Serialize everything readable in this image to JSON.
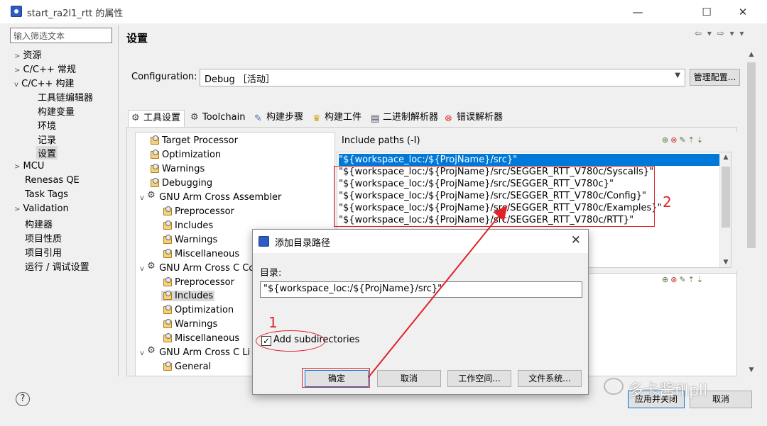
{
  "window": {
    "title": "start_ra2l1_rtt 的属性",
    "controls": [
      "—",
      "☐",
      "✕"
    ]
  },
  "left_panel": {
    "filter_placeholder": "输入筛选文本",
    "items": [
      {
        "label": "资源",
        "twisty": ">"
      },
      {
        "label": "C/C++ 常规",
        "twisty": ">"
      },
      {
        "label": "C/C++ 构建",
        "twisty": "v"
      },
      {
        "label": "工具链编辑器"
      },
      {
        "label": "构建变量"
      },
      {
        "label": "环境"
      },
      {
        "label": "记录"
      },
      {
        "label": "设置"
      },
      {
        "label": "MCU",
        "twisty": ">"
      },
      {
        "label": "Renesas QE"
      },
      {
        "label": "Task Tags"
      },
      {
        "label": "Validation",
        "twisty": ">"
      },
      {
        "label": "构建器"
      },
      {
        "label": "项目性质"
      },
      {
        "label": "项目引用"
      },
      {
        "label": "运行 / 调试设置"
      }
    ]
  },
  "header": {
    "title": "设置",
    "nav": "⇦ ▾ ⇨ ▾ ▾"
  },
  "configuration": {
    "label": "Configuration:",
    "value": "Debug ［活动］",
    "manage_button": "管理配置..."
  },
  "tabs": [
    {
      "label": "工具设置",
      "active": true
    },
    {
      "label": "Toolchain"
    },
    {
      "label": "构建步骤"
    },
    {
      "label": "构建工件"
    },
    {
      "label": "二进制解析器"
    },
    {
      "label": "错误解析器"
    }
  ],
  "tool_tree": [
    {
      "label": "Target Processor"
    },
    {
      "label": "Optimization"
    },
    {
      "label": "Warnings"
    },
    {
      "label": "Debugging"
    },
    {
      "label": "GNU Arm Cross Assembler",
      "twisty": "v"
    },
    {
      "label": "Preprocessor"
    },
    {
      "label": "Includes"
    },
    {
      "label": "Warnings"
    },
    {
      "label": "Miscellaneous"
    },
    {
      "label": "GNU Arm Cross C Co",
      "twisty": "v"
    },
    {
      "label": "Preprocessor"
    },
    {
      "label": "Includes",
      "selected": true
    },
    {
      "label": "Optimization"
    },
    {
      "label": "Warnings"
    },
    {
      "label": "Miscellaneous"
    },
    {
      "label": "GNU Arm Cross C Li",
      "twisty": "v"
    },
    {
      "label": "General"
    }
  ],
  "include_panel": {
    "title": "Include paths (-I)",
    "paths": [
      "\"${workspace_loc:/${ProjName}/src}\"",
      "\"${workspace_loc:/${ProjName}/src/SEGGER_RTT_V780c/Syscalls}\"",
      "\"${workspace_loc:/${ProjName}/src/SEGGER_RTT_V780c}\"",
      "\"${workspace_loc:/${ProjName}/src/SEGGER_RTT_V780c/Config}\"",
      "\"${workspace_loc:/${ProjName}/src/SEGGER_RTT_V780c/Examples}\"",
      "\"${workspace_loc:/${ProjName}/src/SEGGER_RTT_V780c/RTT}\""
    ],
    "toolbar_icons": [
      "add-icon",
      "delete-icon",
      "edit-icon",
      "move-up-icon",
      "move-down-icon"
    ]
  },
  "annotations": {
    "n1": "1",
    "n2": "2"
  },
  "dialog": {
    "title": "添加目录路径",
    "label": "目录:",
    "value": "\"${workspace_loc:/${ProjName}/src}\"",
    "checkbox_label": "Add subdirectories",
    "checkbox_checked": true,
    "buttons": [
      "确定",
      "取消",
      "工作空间...",
      "文件系统..."
    ]
  },
  "bottom": {
    "apply_close": "应用并关闭",
    "cancel": "取消",
    "help": "?"
  },
  "watermark": "多卡酱fllpll",
  "colors": {
    "selection": "#0078d7",
    "annotation_red": "#e0232a"
  }
}
